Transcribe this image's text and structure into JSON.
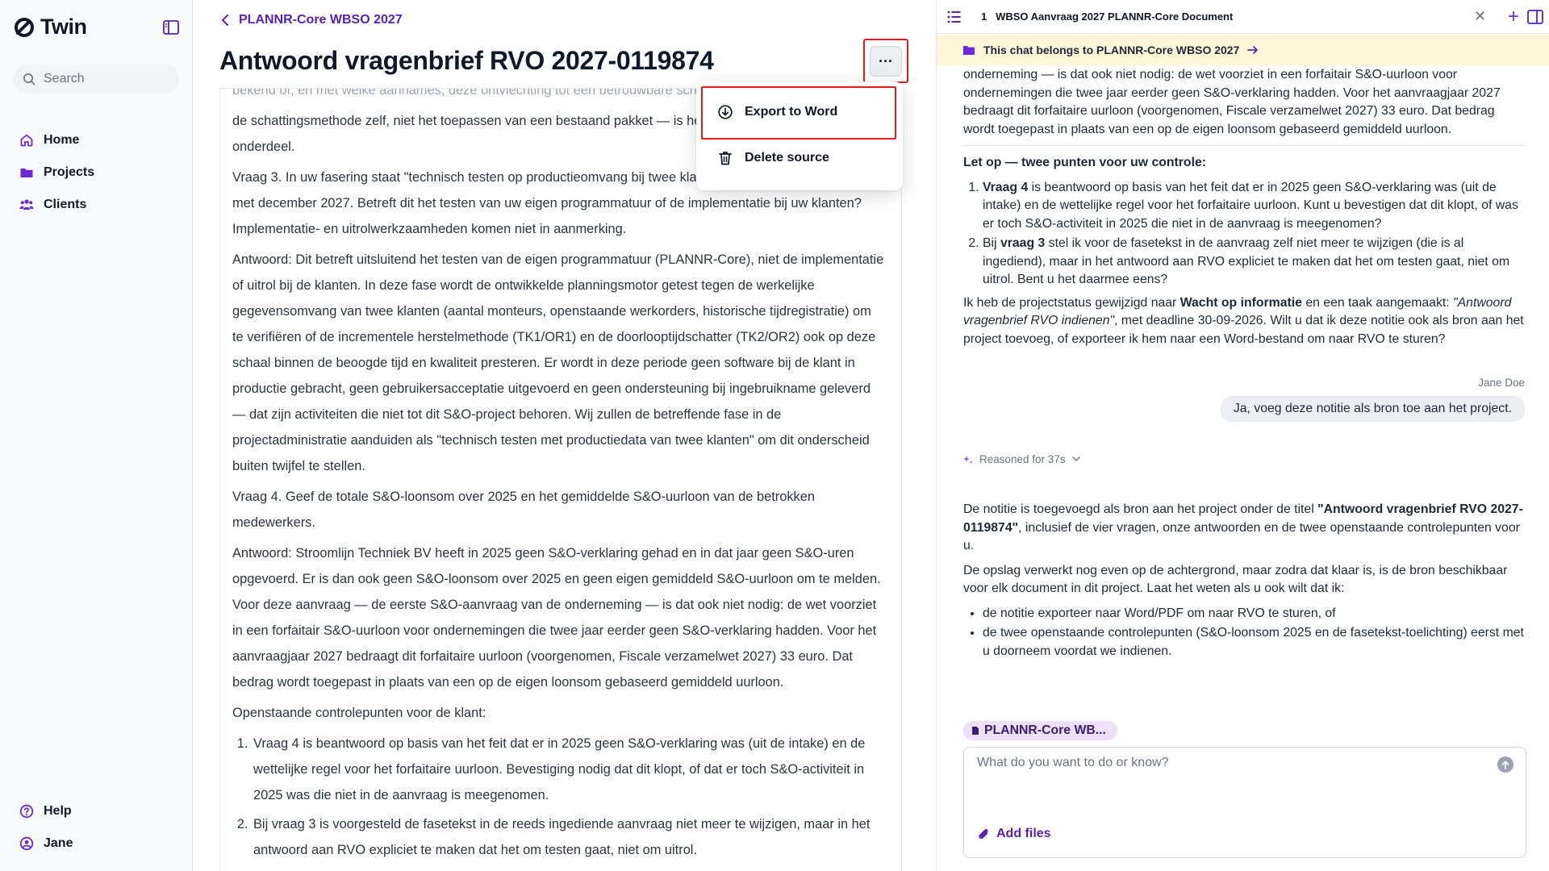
{
  "sidebar": {
    "logo_text": "Twin",
    "search_placeholder": "Search",
    "nav": [
      "Home",
      "Projects",
      "Clients"
    ],
    "bottom": [
      "Help",
      "Jane"
    ]
  },
  "main": {
    "breadcrumb": "PLANNR-Core WBSO 2027",
    "title": "Antwoord vragenbrief RVO 2027-0119874",
    "more_label": "···",
    "menu": {
      "export": "Export to Word",
      "delete": "Delete source"
    },
    "doc": {
      "faded_line": "bekend of, en met welke aannames, deze ontvlechting tot een betrouwbare schatting leidt.",
      "p1": "de schattingsmethode zelf, niet het toepassen van een bestaand pakket — is het technisch nieuwe in dit onderdeel.",
      "q3": "Vraag 3. In uw fasering staat \"technisch testen op productieomvang bij twee klanten\" voor de periode juli tot en met december 2027. Betreft dit het testen van uw eigen programmatuur of de implementatie bij uw klanten? Implementatie- en uitrolwerkzaamheden komen niet in aanmerking.",
      "a3": "Antwoord: Dit betreft uitsluitend het testen van de eigen programmatuur (PLANNR-Core), niet de implementatie of uitrol bij de klanten. In deze fase wordt de ontwikkelde planningsmotor getest tegen de werkelijke gegevensomvang van twee klanten (aantal monteurs, openstaande werkorders, historische tijdregistratie) om te verifiëren of de incrementele herstelmethode (TK1/OR1) en de doorlooptijdschatter (TK2/OR2) ook op deze schaal binnen de beoogde tijd en kwaliteit presteren. Er wordt in deze periode geen software bij de klant in productie gebracht, geen gebruikersacceptatie uitgevoerd en geen ondersteuning bij ingebruikname geleverd — dat zijn activiteiten die niet tot dit S&O-project behoren. Wij zullen de betreffende fase in de projectadministratie aanduiden als \"technisch testen met productiedata van twee klanten\" om dit onderscheid buiten twijfel te stellen.",
      "q4": "Vraag 4. Geef de totale S&O-loonsom over 2025 en het gemiddelde S&O-uurloon van de betrokken medewerkers.",
      "a4": "Antwoord: Stroomlijn Techniek BV heeft in 2025 geen S&O-verklaring gehad en in dat jaar geen S&O-uren opgevoerd. Er is dan ook geen S&O-loonsom over 2025 en geen eigen gemiddeld S&O-uurloon om te melden. Voor deze aanvraag — de eerste S&O-aanvraag van de onderneming — is dat ook niet nodig: de wet voorziet in een forfaitair S&O-uurloon voor ondernemingen die twee jaar eerder geen S&O-verklaring hadden. Voor het aanvraagjaar 2027 bedraagt dit forfaitaire uurloon (voorgenomen, Fiscale verzamelwet 2027) 33 euro. Dat bedrag wordt toegepast in plaats van een op de eigen loonsom gebaseerd gemiddeld uurloon.",
      "open_heading": "Openstaande controlepunten voor de klant:",
      "open_items": [
        "Vraag 4 is beantwoord op basis van het feit dat er in 2025 geen S&O-verklaring was (uit de intake) en de wettelijke regel voor het forfaitaire uurloon. Bevestiging nodig dat dit klopt, of dat er toch S&O-activiteit in 2025 was die niet in de aanvraag is meegenomen.",
        "Bij vraag 3 is voorgesteld de fasetekst in de reeds ingediende aanvraag niet meer te wijzigen, maar in het antwoord aan RVO expliciet te maken dat het om testen gaat, niet om uitrol."
      ]
    }
  },
  "panel": {
    "tab_number": "1",
    "tab_label": "WBSO Aanvraag 2027 PLANNR-Core Document",
    "belongs_text": "This chat belongs to PLANNR-Core WBSO 2027",
    "msg1_p1": "onderneming — is dat ook niet nodig: de wet voorziet in een forfaitair S&O-uurloon voor ondernemingen die twee jaar eerder geen S&O-verklaring hadden. Voor het aanvraagjaar 2027 bedraagt dit forfaitaire uurloon (voorgenomen, Fiscale verzamelwet 2027) 33 euro. Dat bedrag wordt toegepast in plaats van een op de eigen loonsom gebaseerd gemiddeld uurloon.",
    "msg1_heading": "Let op — twee punten voor uw controle:",
    "msg1_li1_bold": "Vraag 4",
    "msg1_li1_rest": " is beantwoord op basis van het feit dat er in 2025 geen S&O-verklaring was (uit de intake) en de wettelijke regel voor het forfaitaire uurloon. Kunt u bevestigen dat dit klopt, of was er toch S&O-activiteit in 2025 die niet in de aanvraag is meegenomen?",
    "msg1_li2_pre": "Bij ",
    "msg1_li2_bold": "vraag 3",
    "msg1_li2_rest": " stel ik voor de fasetekst in de aanvraag zelf niet meer te wijzigen (die is al ingediend), maar in het antwoord aan RVO expliciet te maken dat het om testen gaat, niet om uitrol. Bent u het daarmee eens?",
    "msg1_p2_pre": "Ik heb de projectstatus gewijzigd naar ",
    "msg1_p2_bold": "Wacht op informatie",
    "msg1_p2_mid": " en een taak aangemaakt: ",
    "msg1_p2_italic": "\"Antwoord vragenbrief RVO indienen\"",
    "msg1_p2_rest": ", met deadline 30-09-2026. Wilt u dat ik deze notitie ook als bron aan het project toevoeg, of exporteer ik hem naar een Word-bestand om naar RVO te sturen?",
    "user_name": "Jane Doe",
    "user_msg": "Ja, voeg deze notitie als bron toe aan het project.",
    "reasoned": "Reasoned for 37s",
    "msg2_p1_pre": "De notitie is toegevoegd als bron aan het project onder de titel ",
    "msg2_p1_bold": "\"Antwoord vragenbrief RVO 2027-0119874\"",
    "msg2_p1_rest": ", inclusief de vier vragen, onze antwoorden en de twee openstaande controlepunten voor u.",
    "msg2_p2": "De opslag verwerkt nog even op de achtergrond, maar zodra dat klaar is, is de bron beschikbaar voor elk document in dit project. Laat het weten als u ook wilt dat ik:",
    "msg2_bullets": [
      "de notitie exporteer naar Word/PDF om naar RVO te sturen, of",
      "de twee openstaande controlepunten (S&O-loonsom 2025 en de fasetekst-toelichting) eerst met u doorneem voordat we indienen."
    ],
    "chip_label": "PLANNR-Core WB...",
    "composer_placeholder": "What do you want to do or know?",
    "add_files": "Add files"
  },
  "colors": {
    "accent": "#5b21b6",
    "highlight_border": "#e11d1d",
    "banner_bg": "#fdf6d8",
    "chip_bg": "#ede0fb"
  }
}
